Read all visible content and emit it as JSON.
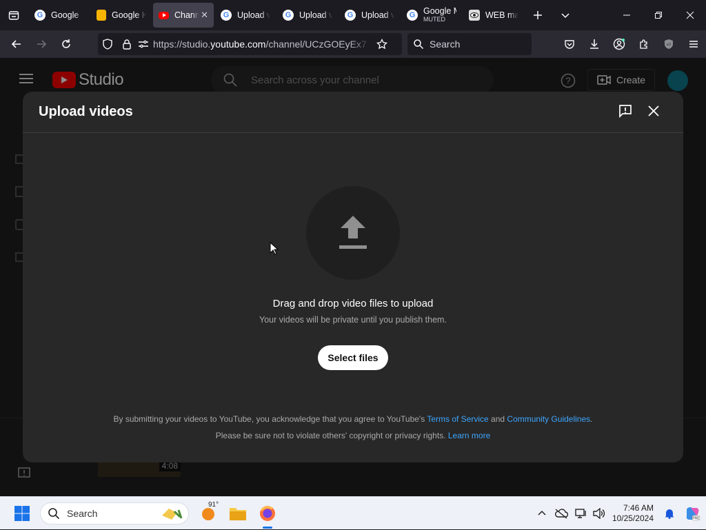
{
  "browser": {
    "tabs": [
      {
        "title": "Google",
        "favicon": "google-g-icon",
        "active": false
      },
      {
        "title": "Google K",
        "favicon": "google-keep-icon",
        "active": false
      },
      {
        "title": "Chann",
        "favicon": "youtube-icon",
        "active": true
      },
      {
        "title": "Upload v",
        "favicon": "google-g-icon",
        "active": false
      },
      {
        "title": "Upload v",
        "favicon": "google-g-icon",
        "active": false
      },
      {
        "title": "Upload v",
        "favicon": "google-g-icon",
        "active": false
      },
      {
        "title": "Google M",
        "subtitle": "MUTED",
        "favicon": "google-g-icon",
        "active": false
      },
      {
        "title": "WEB ma",
        "favicon": "web-eye-icon",
        "active": false
      }
    ],
    "url_prefix": "https://studio.",
    "url_domain": "youtube.com",
    "url_path": "/channel/UCzGOEyEx7",
    "search_placeholder": "Search"
  },
  "studio": {
    "logo_text": "Studio",
    "search_placeholder": "Search across your channel",
    "create_label": "Create"
  },
  "dialog": {
    "title": "Upload videos",
    "drag_title": "Drag and drop video files to upload",
    "drag_subtitle": "Your videos will be private until you publish them.",
    "select_button": "Select files",
    "legal_line1_pre": "By submitting your videos to YouTube, you acknowledge that you agree to YouTube's",
    "terms_link": "Terms of Service",
    "legal_and": "and",
    "guidelines_link": "Community Guidelines",
    "legal_period": ".",
    "legal_line2_pre": "Please be sure not to violate others' copyright or privacy rights.",
    "learn_more_link": "Learn more"
  },
  "background": {
    "video_duration": "4:08"
  },
  "taskbar": {
    "search_label": "Search",
    "weather_temp": "91°",
    "time": "7:46 AM",
    "date": "10/25/2024"
  },
  "colors": {
    "link": "#3ea6ff",
    "youtube_red": "#ff0000",
    "dialog_bg": "#282828"
  }
}
